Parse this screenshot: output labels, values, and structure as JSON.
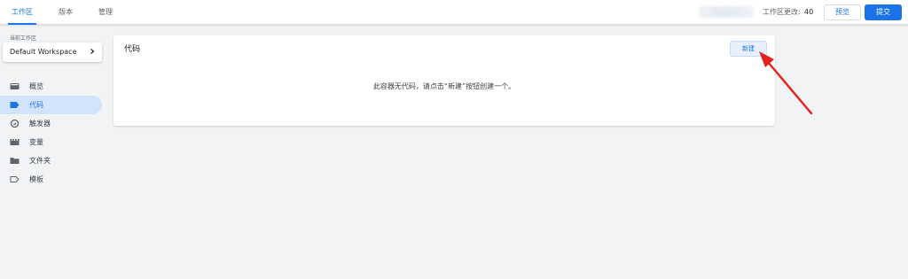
{
  "header": {
    "tabs": [
      {
        "label": "工作区",
        "active": true
      },
      {
        "label": "版本",
        "active": false
      },
      {
        "label": "管理",
        "active": false
      }
    ],
    "changes_label": "工作区更改:",
    "changes_count": "40",
    "preview_label": "预览",
    "submit_label": "提交"
  },
  "sidebar": {
    "workspace_label": "当前工作区",
    "workspace_name": "Default Workspace",
    "items": [
      {
        "label": "概览",
        "icon": "overview-icon",
        "active": false
      },
      {
        "label": "代码",
        "icon": "tag-icon",
        "active": true
      },
      {
        "label": "触发器",
        "icon": "trigger-icon",
        "active": false
      },
      {
        "label": "变量",
        "icon": "variable-icon",
        "active": false
      },
      {
        "label": "文件夹",
        "icon": "folder-icon",
        "active": false
      },
      {
        "label": "模板",
        "icon": "template-icon",
        "active": false
      }
    ]
  },
  "main": {
    "title": "代码",
    "new_button": "新建",
    "empty_message": "此容器无代码，请点击“新建”按钮创建一个。"
  },
  "colors": {
    "accent": "#1a73e8",
    "active_nav_bg": "#d2e3fc",
    "annotation_arrow": "#e8201c"
  }
}
